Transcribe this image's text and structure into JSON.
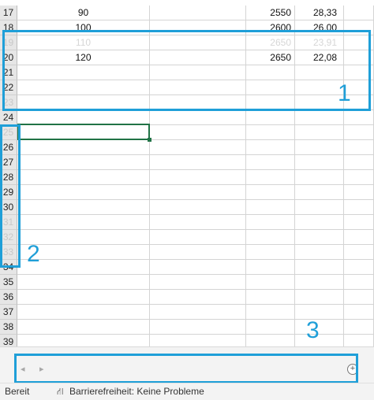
{
  "sheet": {
    "rows": [
      {
        "num": "17",
        "b": "90",
        "d": "2550",
        "e": "28,33"
      },
      {
        "num": "18",
        "b": "100",
        "d": "2600",
        "e": "26,00"
      },
      {
        "num": "19",
        "b": "110",
        "d": "2650",
        "e": "23,91"
      },
      {
        "num": "20",
        "b": "120",
        "d": "2650",
        "e": "22,08"
      },
      {
        "num": "21",
        "b": "",
        "d": "",
        "e": ""
      },
      {
        "num": "22",
        "b": "",
        "d": "",
        "e": ""
      },
      {
        "num": "23",
        "b": "",
        "d": "",
        "e": ""
      },
      {
        "num": "24",
        "b": "",
        "d": "",
        "e": ""
      },
      {
        "num": "25",
        "b": "",
        "d": "",
        "e": ""
      },
      {
        "num": "26",
        "b": "",
        "d": "",
        "e": ""
      },
      {
        "num": "27",
        "b": "",
        "d": "",
        "e": ""
      },
      {
        "num": "28",
        "b": "",
        "d": "",
        "e": ""
      },
      {
        "num": "29",
        "b": "",
        "d": "",
        "e": ""
      },
      {
        "num": "30",
        "b": "",
        "d": "",
        "e": ""
      },
      {
        "num": "31",
        "b": "",
        "d": "",
        "e": ""
      },
      {
        "num": "32",
        "b": "",
        "d": "",
        "e": ""
      },
      {
        "num": "33",
        "b": "",
        "d": "",
        "e": ""
      },
      {
        "num": "34",
        "b": "",
        "d": "",
        "e": ""
      },
      {
        "num": "35",
        "b": "",
        "d": "",
        "e": ""
      },
      {
        "num": "36",
        "b": "",
        "d": "",
        "e": ""
      },
      {
        "num": "37",
        "b": "",
        "d": "",
        "e": ""
      },
      {
        "num": "38",
        "b": "",
        "d": "",
        "e": ""
      },
      {
        "num": "39",
        "b": "",
        "d": "",
        "e": ""
      }
    ]
  },
  "annotations": {
    "box1": "1",
    "box2": "2",
    "box3": "3"
  },
  "tabbar": {
    "prev_icon": "◂",
    "next_icon": "▸",
    "add_icon": "+"
  },
  "statusbar": {
    "ready": "Bereit",
    "accessibility": "Barrierefreiheit: Keine Probleme",
    "accessibility_icon": "⛙"
  },
  "colors": {
    "annotation": "#1f9fd8",
    "selection": "#217346"
  }
}
